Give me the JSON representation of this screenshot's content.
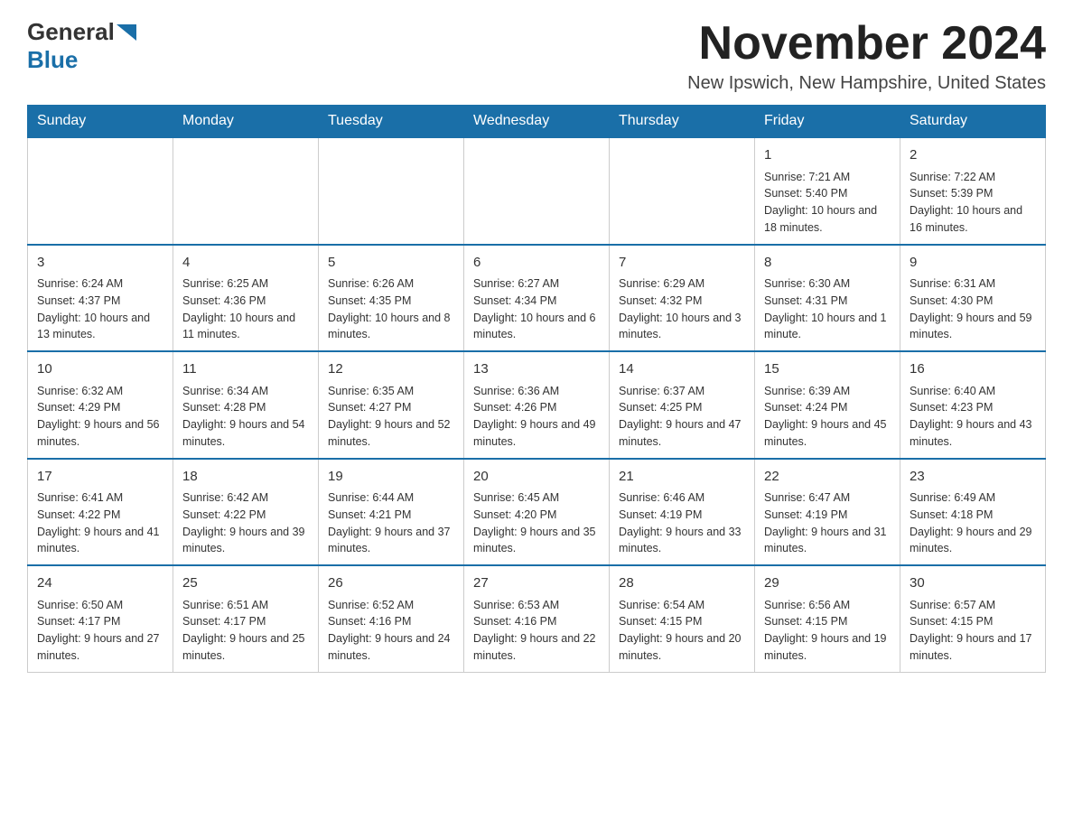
{
  "header": {
    "logo_general": "General",
    "logo_blue": "Blue",
    "month_title": "November 2024",
    "location": "New Ipswich, New Hampshire, United States"
  },
  "days_of_week": [
    "Sunday",
    "Monday",
    "Tuesday",
    "Wednesday",
    "Thursday",
    "Friday",
    "Saturday"
  ],
  "weeks": [
    [
      {
        "day": "",
        "info": ""
      },
      {
        "day": "",
        "info": ""
      },
      {
        "day": "",
        "info": ""
      },
      {
        "day": "",
        "info": ""
      },
      {
        "day": "",
        "info": ""
      },
      {
        "day": "1",
        "info": "Sunrise: 7:21 AM\nSunset: 5:40 PM\nDaylight: 10 hours and 18 minutes."
      },
      {
        "day": "2",
        "info": "Sunrise: 7:22 AM\nSunset: 5:39 PM\nDaylight: 10 hours and 16 minutes."
      }
    ],
    [
      {
        "day": "3",
        "info": "Sunrise: 6:24 AM\nSunset: 4:37 PM\nDaylight: 10 hours and 13 minutes."
      },
      {
        "day": "4",
        "info": "Sunrise: 6:25 AM\nSunset: 4:36 PM\nDaylight: 10 hours and 11 minutes."
      },
      {
        "day": "5",
        "info": "Sunrise: 6:26 AM\nSunset: 4:35 PM\nDaylight: 10 hours and 8 minutes."
      },
      {
        "day": "6",
        "info": "Sunrise: 6:27 AM\nSunset: 4:34 PM\nDaylight: 10 hours and 6 minutes."
      },
      {
        "day": "7",
        "info": "Sunrise: 6:29 AM\nSunset: 4:32 PM\nDaylight: 10 hours and 3 minutes."
      },
      {
        "day": "8",
        "info": "Sunrise: 6:30 AM\nSunset: 4:31 PM\nDaylight: 10 hours and 1 minute."
      },
      {
        "day": "9",
        "info": "Sunrise: 6:31 AM\nSunset: 4:30 PM\nDaylight: 9 hours and 59 minutes."
      }
    ],
    [
      {
        "day": "10",
        "info": "Sunrise: 6:32 AM\nSunset: 4:29 PM\nDaylight: 9 hours and 56 minutes."
      },
      {
        "day": "11",
        "info": "Sunrise: 6:34 AM\nSunset: 4:28 PM\nDaylight: 9 hours and 54 minutes."
      },
      {
        "day": "12",
        "info": "Sunrise: 6:35 AM\nSunset: 4:27 PM\nDaylight: 9 hours and 52 minutes."
      },
      {
        "day": "13",
        "info": "Sunrise: 6:36 AM\nSunset: 4:26 PM\nDaylight: 9 hours and 49 minutes."
      },
      {
        "day": "14",
        "info": "Sunrise: 6:37 AM\nSunset: 4:25 PM\nDaylight: 9 hours and 47 minutes."
      },
      {
        "day": "15",
        "info": "Sunrise: 6:39 AM\nSunset: 4:24 PM\nDaylight: 9 hours and 45 minutes."
      },
      {
        "day": "16",
        "info": "Sunrise: 6:40 AM\nSunset: 4:23 PM\nDaylight: 9 hours and 43 minutes."
      }
    ],
    [
      {
        "day": "17",
        "info": "Sunrise: 6:41 AM\nSunset: 4:22 PM\nDaylight: 9 hours and 41 minutes."
      },
      {
        "day": "18",
        "info": "Sunrise: 6:42 AM\nSunset: 4:22 PM\nDaylight: 9 hours and 39 minutes."
      },
      {
        "day": "19",
        "info": "Sunrise: 6:44 AM\nSunset: 4:21 PM\nDaylight: 9 hours and 37 minutes."
      },
      {
        "day": "20",
        "info": "Sunrise: 6:45 AM\nSunset: 4:20 PM\nDaylight: 9 hours and 35 minutes."
      },
      {
        "day": "21",
        "info": "Sunrise: 6:46 AM\nSunset: 4:19 PM\nDaylight: 9 hours and 33 minutes."
      },
      {
        "day": "22",
        "info": "Sunrise: 6:47 AM\nSunset: 4:19 PM\nDaylight: 9 hours and 31 minutes."
      },
      {
        "day": "23",
        "info": "Sunrise: 6:49 AM\nSunset: 4:18 PM\nDaylight: 9 hours and 29 minutes."
      }
    ],
    [
      {
        "day": "24",
        "info": "Sunrise: 6:50 AM\nSunset: 4:17 PM\nDaylight: 9 hours and 27 minutes."
      },
      {
        "day": "25",
        "info": "Sunrise: 6:51 AM\nSunset: 4:17 PM\nDaylight: 9 hours and 25 minutes."
      },
      {
        "day": "26",
        "info": "Sunrise: 6:52 AM\nSunset: 4:16 PM\nDaylight: 9 hours and 24 minutes."
      },
      {
        "day": "27",
        "info": "Sunrise: 6:53 AM\nSunset: 4:16 PM\nDaylight: 9 hours and 22 minutes."
      },
      {
        "day": "28",
        "info": "Sunrise: 6:54 AM\nSunset: 4:15 PM\nDaylight: 9 hours and 20 minutes."
      },
      {
        "day": "29",
        "info": "Sunrise: 6:56 AM\nSunset: 4:15 PM\nDaylight: 9 hours and 19 minutes."
      },
      {
        "day": "30",
        "info": "Sunrise: 6:57 AM\nSunset: 4:15 PM\nDaylight: 9 hours and 17 minutes."
      }
    ]
  ]
}
